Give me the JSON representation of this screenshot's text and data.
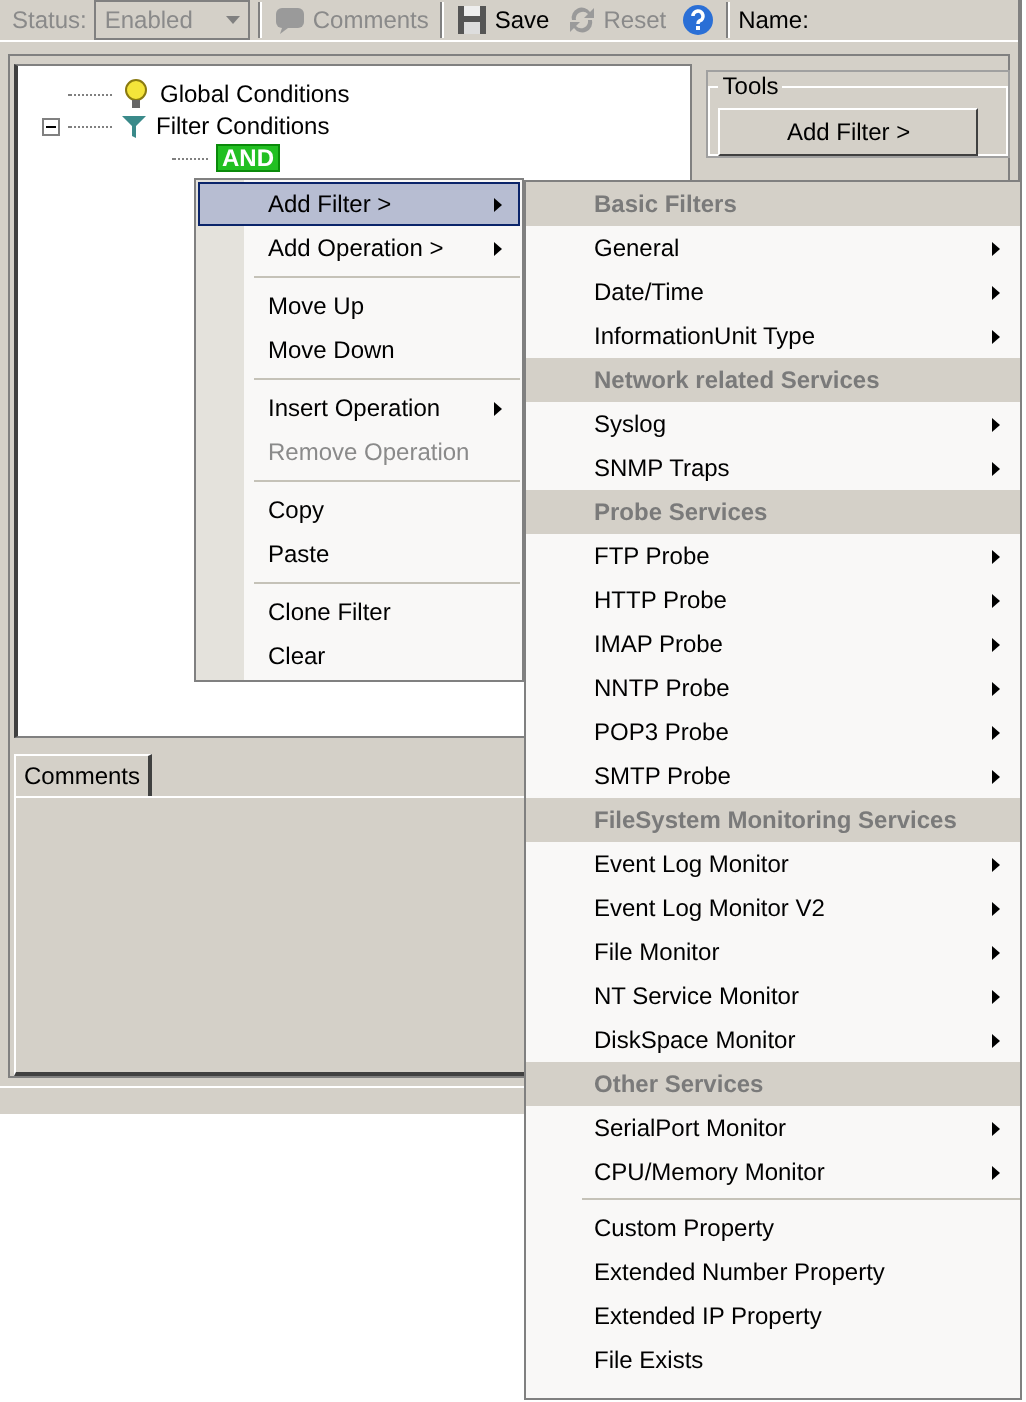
{
  "toolbar": {
    "status_label": "Status:",
    "status_value": "Enabled",
    "status_disabled": true,
    "buttons": [
      {
        "kind": "comments",
        "label": "Comments",
        "disabled": true
      },
      {
        "kind": "save",
        "label": "Save",
        "disabled": false
      },
      {
        "kind": "reset",
        "label": "Reset",
        "disabled": true
      },
      {
        "kind": "help",
        "disabled": false
      }
    ],
    "name_label": "Name:"
  },
  "tree": [
    {
      "kind": "bulb",
      "label": "Global Conditions"
    },
    {
      "kind": "funnel",
      "label": "Filter Conditions",
      "expanded": true,
      "children": [
        {
          "kind": "operation",
          "label": "AND"
        }
      ]
    }
  ],
  "tools": {
    "title": "Tools",
    "button": "Add Filter >"
  },
  "comments_tab": {
    "label": "Comments",
    "selected": true
  },
  "context_menu": [
    {
      "kind": "item",
      "label": "Add Filter >",
      "submenu": true,
      "selected": true,
      "disabled": false
    },
    {
      "kind": "item",
      "label": "Add Operation >",
      "submenu": true,
      "selected": false,
      "disabled": false
    },
    {
      "kind": "separator"
    },
    {
      "kind": "item",
      "label": "Move Up",
      "submenu": false,
      "selected": false,
      "disabled": false
    },
    {
      "kind": "item",
      "label": "Move Down",
      "submenu": false,
      "selected": false,
      "disabled": false
    },
    {
      "kind": "separator"
    },
    {
      "kind": "item",
      "label": "Insert Operation",
      "submenu": true,
      "selected": false,
      "disabled": false
    },
    {
      "kind": "item",
      "label": "Remove Operation",
      "submenu": false,
      "selected": false,
      "disabled": true
    },
    {
      "kind": "separator"
    },
    {
      "kind": "item",
      "label": "Copy",
      "submenu": false,
      "selected": false,
      "disabled": false
    },
    {
      "kind": "item",
      "label": "Paste",
      "submenu": false,
      "selected": false,
      "disabled": false
    },
    {
      "kind": "separator"
    },
    {
      "kind": "item",
      "label": "Clone Filter",
      "submenu": false,
      "selected": false,
      "disabled": false
    },
    {
      "kind": "item",
      "label": "Clear",
      "submenu": false,
      "selected": false,
      "disabled": false
    }
  ],
  "filter_menu": [
    {
      "kind": "header",
      "label": "Basic Filters"
    },
    {
      "kind": "item",
      "label": "General",
      "submenu": true
    },
    {
      "kind": "item",
      "label": "Date/Time",
      "submenu": true
    },
    {
      "kind": "item",
      "label": "InformationUnit Type",
      "submenu": true
    },
    {
      "kind": "header",
      "label": "Network related Services"
    },
    {
      "kind": "item",
      "label": "Syslog",
      "submenu": true
    },
    {
      "kind": "item",
      "label": "SNMP Traps",
      "submenu": true
    },
    {
      "kind": "header",
      "label": "Probe Services"
    },
    {
      "kind": "item",
      "label": "FTP Probe",
      "submenu": true
    },
    {
      "kind": "item",
      "label": "HTTP Probe",
      "submenu": true
    },
    {
      "kind": "item",
      "label": "IMAP Probe",
      "submenu": true
    },
    {
      "kind": "item",
      "label": "NNTP Probe",
      "submenu": true
    },
    {
      "kind": "item",
      "label": "POP3 Probe",
      "submenu": true
    },
    {
      "kind": "item",
      "label": "SMTP Probe",
      "submenu": true
    },
    {
      "kind": "header",
      "label": "FileSystem Monitoring Services"
    },
    {
      "kind": "item",
      "label": "Event Log Monitor",
      "submenu": true
    },
    {
      "kind": "item",
      "label": "Event Log Monitor V2",
      "submenu": true
    },
    {
      "kind": "item",
      "label": "File Monitor",
      "submenu": true
    },
    {
      "kind": "item",
      "label": "NT Service Monitor",
      "submenu": true
    },
    {
      "kind": "item",
      "label": "DiskSpace Monitor",
      "submenu": true
    },
    {
      "kind": "header",
      "label": "Other Services"
    },
    {
      "kind": "item",
      "label": "SerialPort Monitor",
      "submenu": true
    },
    {
      "kind": "item",
      "label": "CPU/Memory Monitor",
      "submenu": true
    },
    {
      "kind": "separator"
    },
    {
      "kind": "item",
      "label": "Custom Property",
      "submenu": false
    },
    {
      "kind": "item",
      "label": "Extended Number Property",
      "submenu": false
    },
    {
      "kind": "item",
      "label": "Extended IP Property",
      "submenu": false
    },
    {
      "kind": "item",
      "label": "File Exists",
      "submenu": false
    }
  ]
}
